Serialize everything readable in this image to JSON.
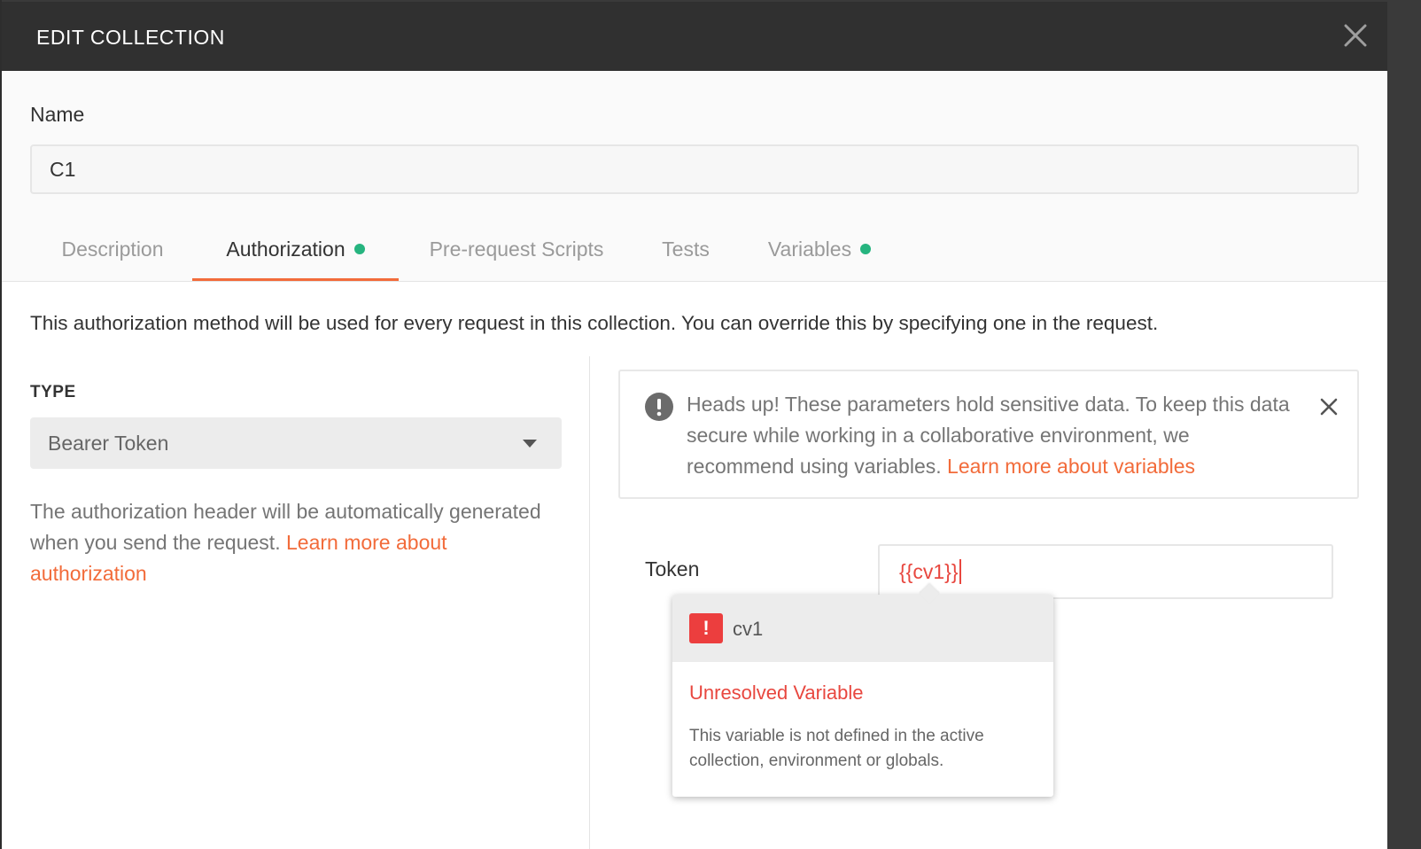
{
  "modal": {
    "title": "EDIT COLLECTION"
  },
  "name_field": {
    "label": "Name",
    "value": "C1"
  },
  "tabs": [
    {
      "label": "Description",
      "active": false,
      "dot": false
    },
    {
      "label": "Authorization",
      "active": true,
      "dot": true
    },
    {
      "label": "Pre-request Scripts",
      "active": false,
      "dot": false
    },
    {
      "label": "Tests",
      "active": false,
      "dot": false
    },
    {
      "label": "Variables",
      "active": false,
      "dot": true
    }
  ],
  "authorization": {
    "intro": "This authorization method will be used for every request in this collection. You can override this by specifying one in the request.",
    "type_label": "TYPE",
    "type_value": "Bearer Token",
    "help_text": "The authorization header will be automatically generated when you send the request. ",
    "help_link": "Learn more about authorization",
    "warning": {
      "text": "Heads up! These parameters hold sensitive data. To keep this data secure while working in a collaborative environment, we recommend using variables. ",
      "link": "Learn more about variables"
    },
    "token_label": "Token",
    "token_value": "{{cv1}}"
  },
  "variable_popup": {
    "badge": "!",
    "variable_name": "cv1",
    "status": "Unresolved Variable",
    "description": "This variable is not defined in the active collection, environment or globals."
  },
  "colors": {
    "accent": "#f26b3a",
    "success_dot": "#26b47f",
    "error": "#e8473f",
    "titlebar": "#303030"
  },
  "icons": {
    "close": "close-icon",
    "warning": "exclamation-circle-icon",
    "dropdown": "caret-down-icon",
    "error_badge": "exclamation-badge-icon"
  }
}
